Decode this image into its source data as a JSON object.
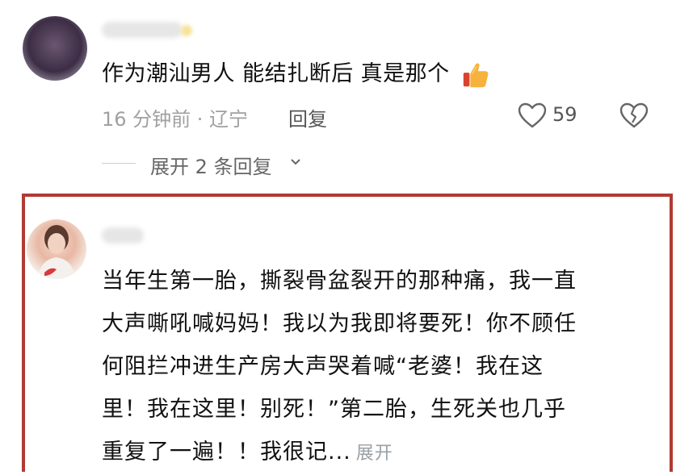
{
  "comments": [
    {
      "text": "作为潮汕男人 能结扎断后 真是那个",
      "emoji": "thumbs-up-icon",
      "time_location": "16 分钟前 · 辽宁",
      "reply_label": "回复",
      "like_count": "59",
      "expand_replies_label": "展开 2 条回复"
    },
    {
      "lines": [
        "当年生第一胎，撕裂骨盆裂开的那种痛，我一直",
        "大声嘶吼喊妈妈！我以为我即将要死！你不顾任",
        "何阻拦冲进生产房大声哭着喊“老婆！我在这",
        "里！我在这里！别死！”第二胎，生死关也几乎",
        "重复了一遍！！我很记..."
      ],
      "more_label": "展开"
    }
  ],
  "colors": {
    "highlight_border": "#b03a34",
    "meta_gray": "#a0a0a0"
  }
}
